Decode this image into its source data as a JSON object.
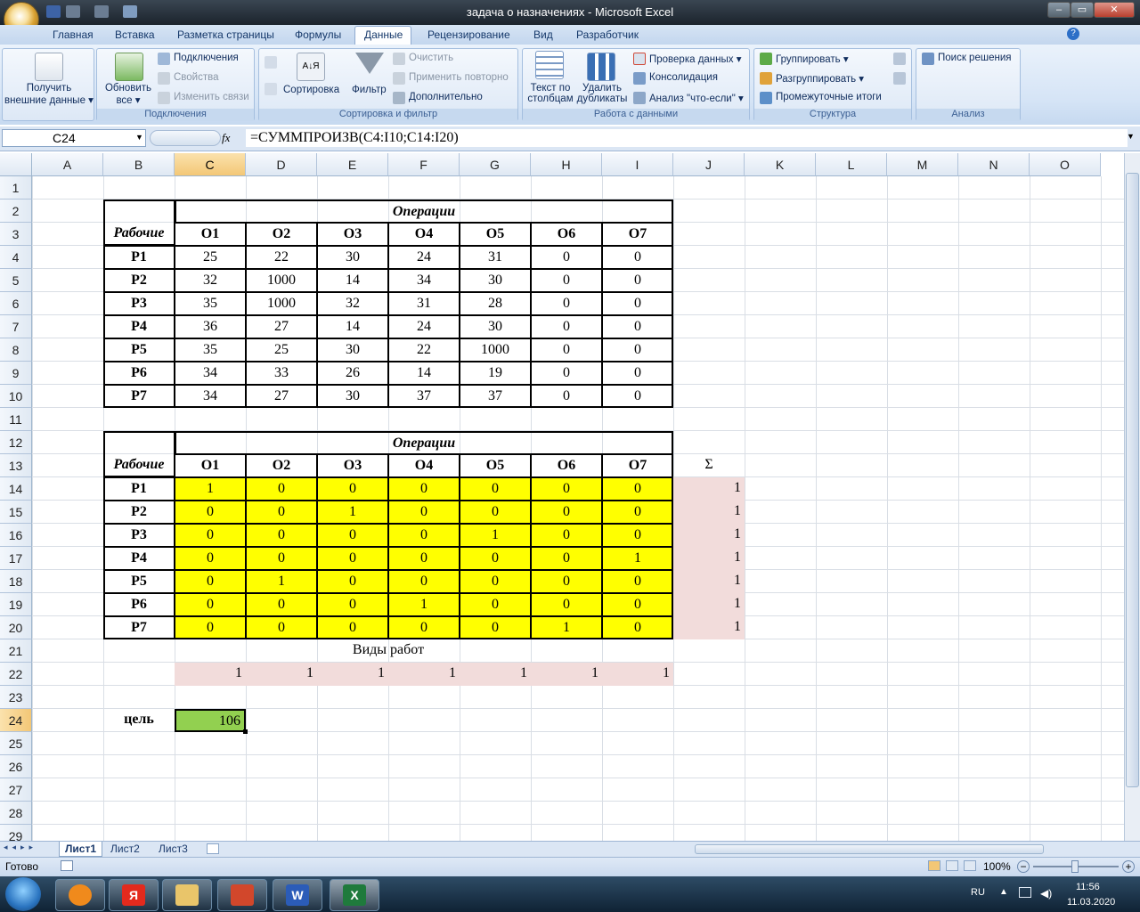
{
  "window": {
    "title": "задача о назначениях - Microsoft Excel",
    "min": "–",
    "max": "▭",
    "close": "✕"
  },
  "ribbon_tabs": [
    "Главная",
    "Вставка",
    "Разметка страницы",
    "Формулы",
    "Данные",
    "Рецензирование",
    "Вид",
    "Разработчик"
  ],
  "ribbon": {
    "get_external": {
      "line1": "Получить",
      "line2": "внешние данные ▾"
    },
    "refresh": {
      "line1": "Обновить",
      "line2": "все ▾"
    },
    "connections": "Подключения",
    "properties": "Свойства",
    "edit_links": "Изменить связи",
    "group_connections": "Подключения",
    "sort_az": "А↓Я",
    "sort": "Сортировка",
    "filter": "Фильтр",
    "clear": "Очистить",
    "reapply": "Применить повторно",
    "advanced": "Дополнительно",
    "group_sort": "Сортировка и фильтр",
    "text_to_columns": {
      "line1": "Текст по",
      "line2": "столбцам"
    },
    "remove_dup": {
      "line1": "Удалить",
      "line2": "дубликаты"
    },
    "data_validation": "Проверка данных ▾",
    "consolidate": "Консолидация",
    "whatif": "Анализ \"что-если\" ▾",
    "group_data_tools": "Работа с данными",
    "group_btn": "Группировать ▾",
    "ungroup": "Разгруппировать ▾",
    "subtotal": "Промежуточные итоги",
    "group_outline": "Структура",
    "solver": "Поиск решения",
    "group_analysis": "Анализ"
  },
  "formula_bar": {
    "name_box": "C24",
    "fx": "fx",
    "formula": "=СУММПРОИЗВ(C4:I10;C14:I20)"
  },
  "columns": [
    "A",
    "B",
    "C",
    "D",
    "E",
    "F",
    "G",
    "H",
    "I",
    "J",
    "K",
    "L",
    "M",
    "N",
    "O"
  ],
  "rows": [
    "1",
    "2",
    "3",
    "4",
    "5",
    "6",
    "7",
    "8",
    "9",
    "10",
    "11",
    "12",
    "13",
    "14",
    "15",
    "16",
    "17",
    "18",
    "19",
    "20",
    "21",
    "22",
    "23",
    "24",
    "25",
    "26",
    "27",
    "28",
    "29"
  ],
  "cost_table": {
    "header": "Операции",
    "row_label": "Рабочие",
    "ops": [
      "O1",
      "O2",
      "O3",
      "O4",
      "O5",
      "O6",
      "O7"
    ],
    "workers": [
      "P1",
      "P2",
      "P3",
      "P4",
      "P5",
      "P6",
      "P7"
    ],
    "values": [
      [
        "25",
        "22",
        "30",
        "24",
        "31",
        "0",
        "0"
      ],
      [
        "32",
        "1000",
        "14",
        "34",
        "30",
        "0",
        "0"
      ],
      [
        "35",
        "1000",
        "32",
        "31",
        "28",
        "0",
        "0"
      ],
      [
        "36",
        "27",
        "14",
        "24",
        "30",
        "0",
        "0"
      ],
      [
        "35",
        "25",
        "30",
        "22",
        "1000",
        "0",
        "0"
      ],
      [
        "34",
        "33",
        "26",
        "14",
        "19",
        "0",
        "0"
      ],
      [
        "34",
        "27",
        "30",
        "37",
        "37",
        "0",
        "0"
      ]
    ]
  },
  "assign_table": {
    "header": "Операции",
    "row_label": "Рабочие",
    "sum_label": "Σ",
    "ops": [
      "O1",
      "O2",
      "O3",
      "O4",
      "O5",
      "O6",
      "O7"
    ],
    "workers": [
      "P1",
      "P2",
      "P3",
      "P4",
      "P5",
      "P6",
      "P7"
    ],
    "values": [
      [
        "1",
        "0",
        "0",
        "0",
        "0",
        "0",
        "0"
      ],
      [
        "0",
        "0",
        "1",
        "0",
        "0",
        "0",
        "0"
      ],
      [
        "0",
        "0",
        "0",
        "0",
        "1",
        "0",
        "0"
      ],
      [
        "0",
        "0",
        "0",
        "0",
        "0",
        "0",
        "1"
      ],
      [
        "0",
        "1",
        "0",
        "0",
        "0",
        "0",
        "0"
      ],
      [
        "0",
        "0",
        "0",
        "1",
        "0",
        "0",
        "0"
      ],
      [
        "0",
        "0",
        "0",
        "0",
        "0",
        "1",
        "0"
      ]
    ],
    "row_sums": [
      "1",
      "1",
      "1",
      "1",
      "1",
      "1",
      "1"
    ],
    "col_label": "Виды работ",
    "col_sums": [
      "1",
      "1",
      "1",
      "1",
      "1",
      "1",
      "1"
    ]
  },
  "goal": {
    "label": "цель",
    "value": "106"
  },
  "sheets": [
    "Лист1",
    "Лист2",
    "Лист3"
  ],
  "status": {
    "ready": "Готово",
    "zoom": "100%"
  },
  "taskbar": {
    "lang": "RU",
    "time": "11:56",
    "date": "11.03.2020"
  },
  "colors": {
    "yellow": "#ffff00",
    "pink": "#f2dcdb",
    "green": "#92d050"
  }
}
